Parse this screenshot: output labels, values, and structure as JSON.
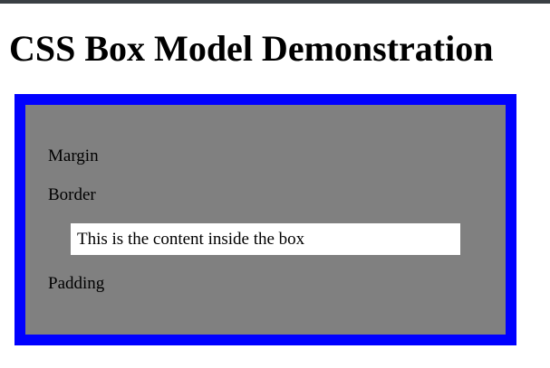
{
  "page": {
    "title": "CSS Box Model Demonstration"
  },
  "box": {
    "margin_label": "Margin",
    "border_label": "Border",
    "content_text": "This is the content inside the box",
    "padding_label": "Padding"
  },
  "colors": {
    "top_bar": "#3a3f44",
    "box_border": "#0000ff",
    "box_background": "#808080",
    "content_background": "#ffffff",
    "text": "#000000"
  }
}
